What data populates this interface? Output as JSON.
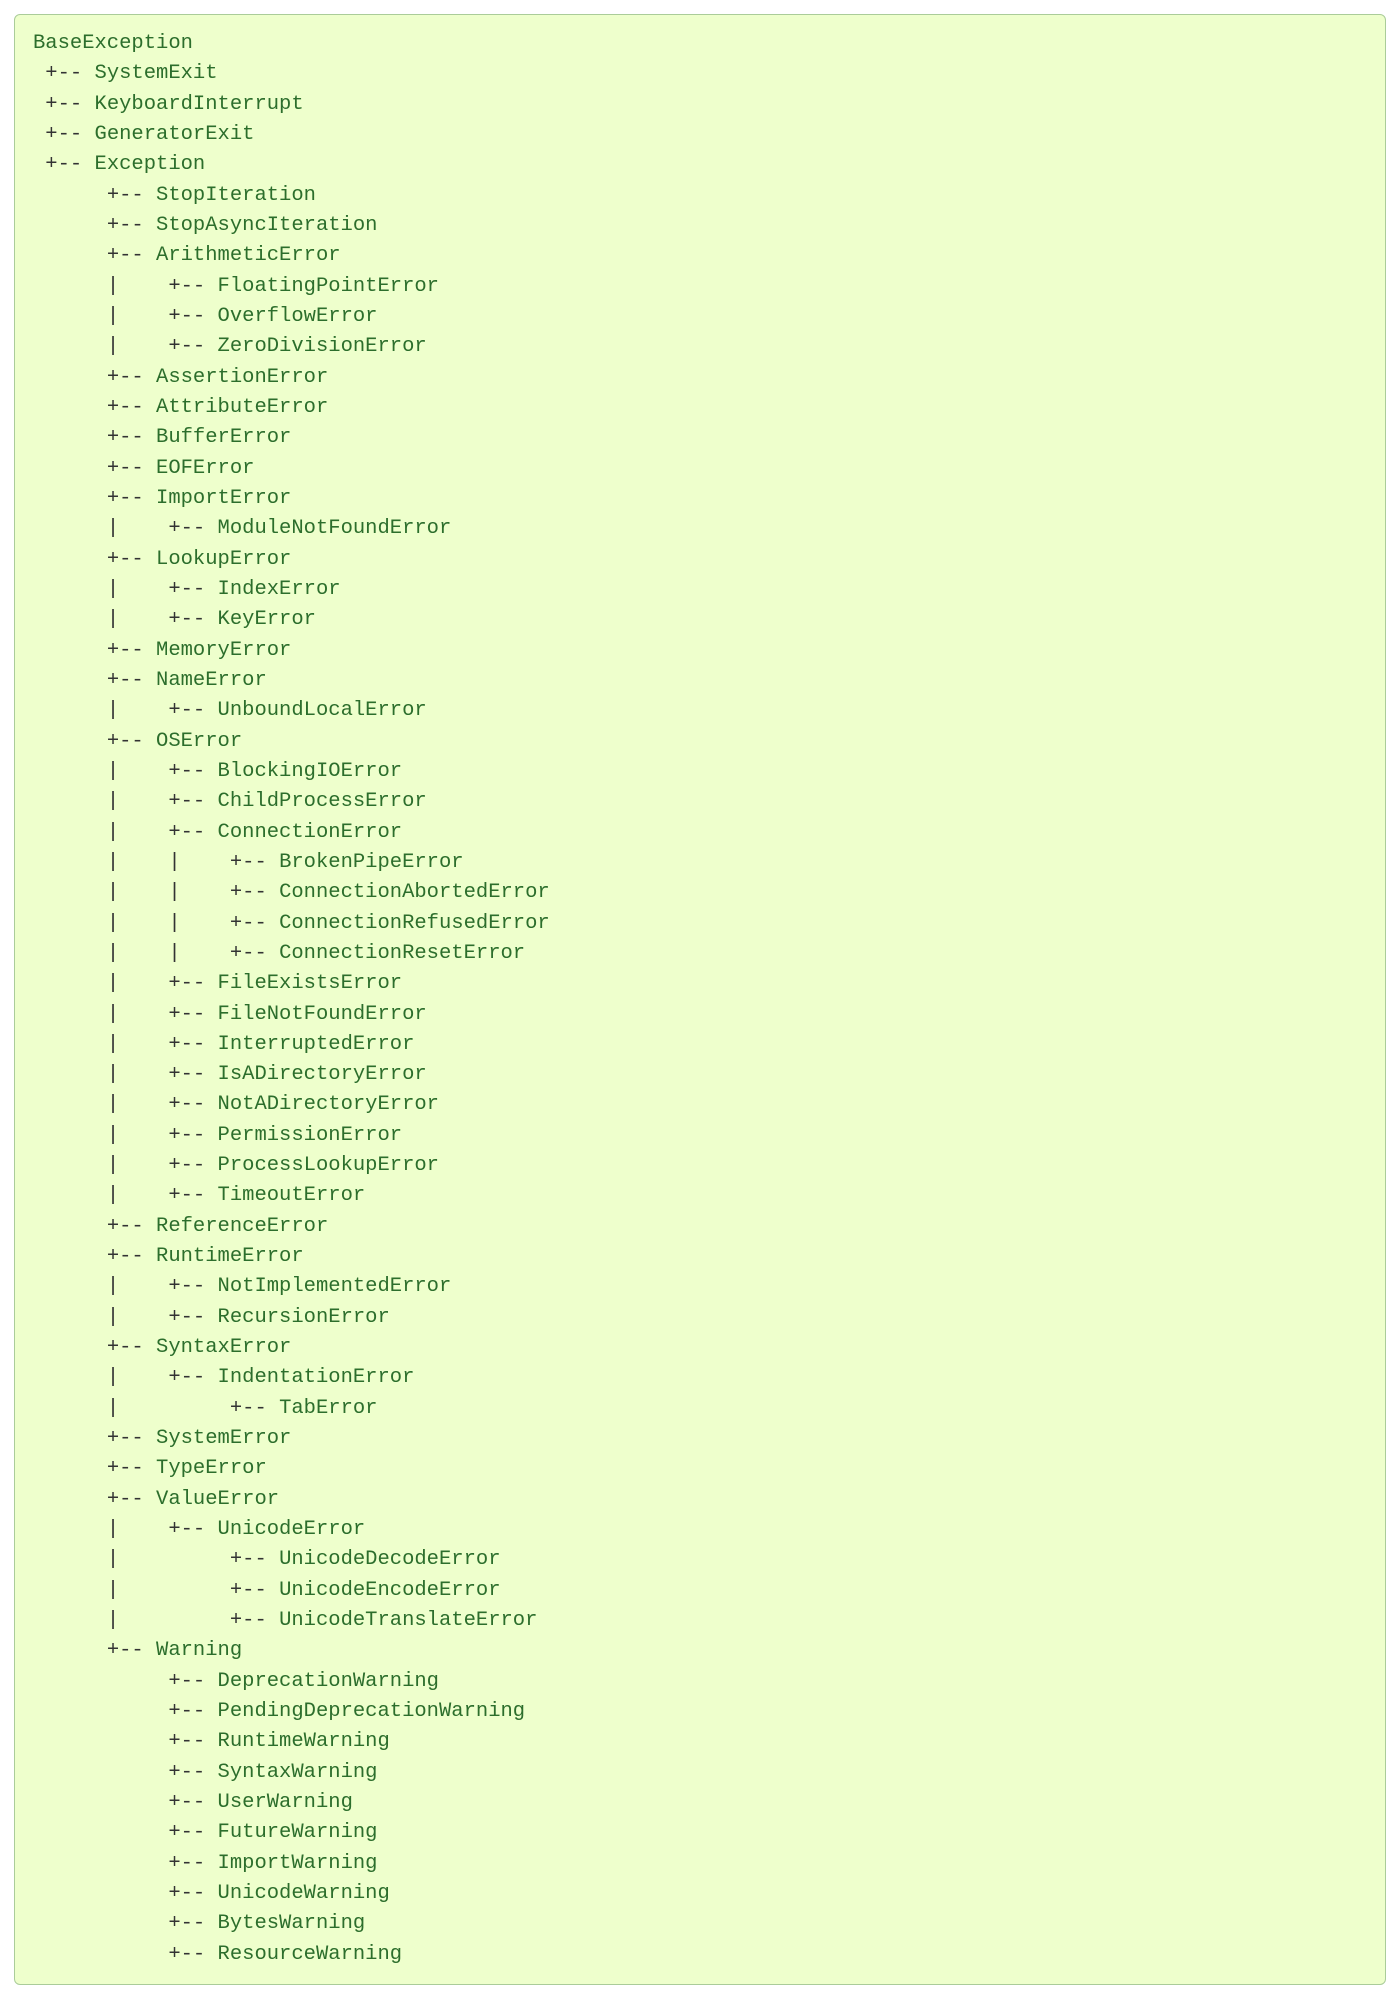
{
  "tree": {
    "name": "BaseException",
    "children": [
      {
        "name": "SystemExit"
      },
      {
        "name": "KeyboardInterrupt"
      },
      {
        "name": "GeneratorExit"
      },
      {
        "name": "Exception",
        "children": [
          {
            "name": "StopIteration"
          },
          {
            "name": "StopAsyncIteration"
          },
          {
            "name": "ArithmeticError",
            "children": [
              {
                "name": "FloatingPointError"
              },
              {
                "name": "OverflowError"
              },
              {
                "name": "ZeroDivisionError"
              }
            ]
          },
          {
            "name": "AssertionError"
          },
          {
            "name": "AttributeError"
          },
          {
            "name": "BufferError"
          },
          {
            "name": "EOFError"
          },
          {
            "name": "ImportError",
            "children": [
              {
                "name": "ModuleNotFoundError"
              }
            ]
          },
          {
            "name": "LookupError",
            "children": [
              {
                "name": "IndexError"
              },
              {
                "name": "KeyError"
              }
            ]
          },
          {
            "name": "MemoryError"
          },
          {
            "name": "NameError",
            "children": [
              {
                "name": "UnboundLocalError"
              }
            ]
          },
          {
            "name": "OSError",
            "children": [
              {
                "name": "BlockingIOError"
              },
              {
                "name": "ChildProcessError"
              },
              {
                "name": "ConnectionError",
                "children": [
                  {
                    "name": "BrokenPipeError"
                  },
                  {
                    "name": "ConnectionAbortedError"
                  },
                  {
                    "name": "ConnectionRefusedError"
                  },
                  {
                    "name": "ConnectionResetError"
                  }
                ]
              },
              {
                "name": "FileExistsError"
              },
              {
                "name": "FileNotFoundError"
              },
              {
                "name": "InterruptedError"
              },
              {
                "name": "IsADirectoryError"
              },
              {
                "name": "NotADirectoryError"
              },
              {
                "name": "PermissionError"
              },
              {
                "name": "ProcessLookupError"
              },
              {
                "name": "TimeoutError"
              }
            ]
          },
          {
            "name": "ReferenceError"
          },
          {
            "name": "RuntimeError",
            "children": [
              {
                "name": "NotImplementedError"
              },
              {
                "name": "RecursionError"
              }
            ]
          },
          {
            "name": "SyntaxError",
            "children": [
              {
                "name": "IndentationError",
                "children": [
                  {
                    "name": "TabError"
                  }
                ]
              }
            ]
          },
          {
            "name": "SystemError"
          },
          {
            "name": "TypeError"
          },
          {
            "name": "ValueError",
            "children": [
              {
                "name": "UnicodeError",
                "children": [
                  {
                    "name": "UnicodeDecodeError"
                  },
                  {
                    "name": "UnicodeEncodeError"
                  },
                  {
                    "name": "UnicodeTranslateError"
                  }
                ]
              }
            ]
          },
          {
            "name": "Warning",
            "children": [
              {
                "name": "DeprecationWarning"
              },
              {
                "name": "PendingDeprecationWarning"
              },
              {
                "name": "RuntimeWarning"
              },
              {
                "name": "SyntaxWarning"
              },
              {
                "name": "UserWarning"
              },
              {
                "name": "FutureWarning"
              },
              {
                "name": "ImportWarning"
              },
              {
                "name": "UnicodeWarning"
              },
              {
                "name": "BytesWarning"
              },
              {
                "name": "ResourceWarning"
              }
            ]
          }
        ]
      }
    ]
  },
  "branch_unit": " +-- ",
  "pipe_unit": " |   ",
  "blank_unit": "     "
}
